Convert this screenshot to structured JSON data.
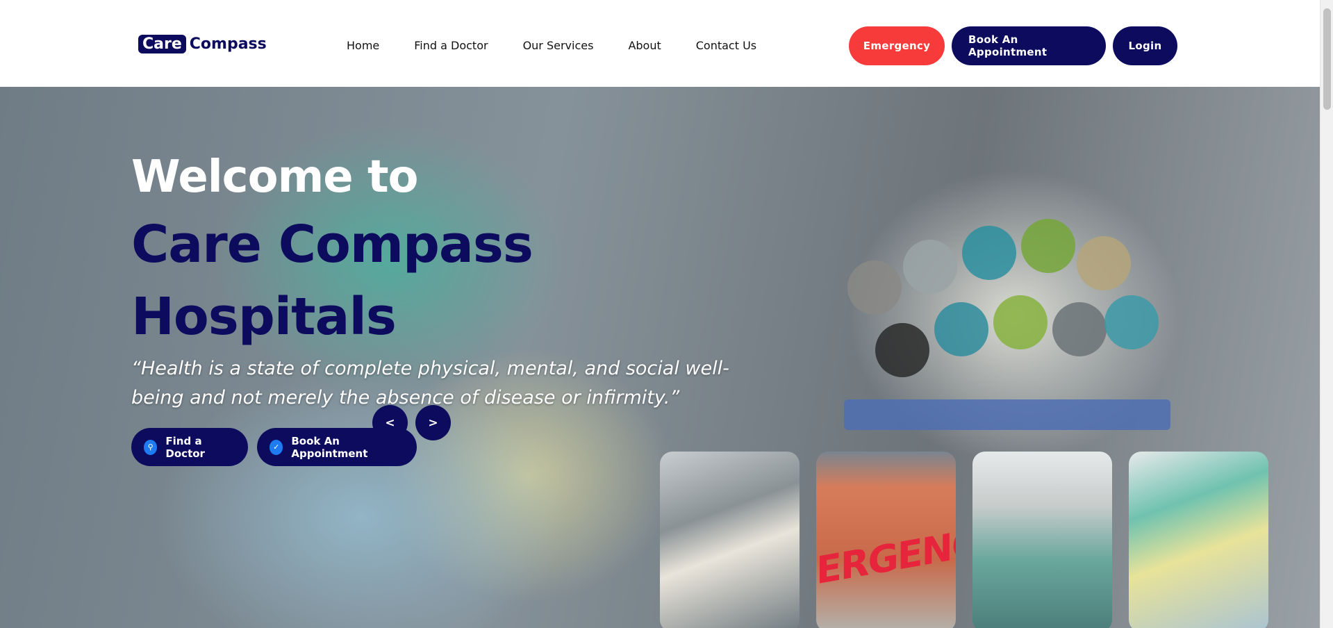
{
  "brand": {
    "logo_box": "Care",
    "logo_text": "Compass"
  },
  "nav": [
    "Home",
    "Find a Doctor",
    "Our Services",
    "About",
    "Contact Us"
  ],
  "header_buttons": {
    "emergency": "Emergency",
    "book": "Book An Appointment",
    "login": "Login"
  },
  "hero": {
    "welcome": "Welcome to",
    "title": "Care Compass Hospitals",
    "quote": "“Health is a state of complete physical, mental, and social well-being and not merely the absence of disease or infirmity.”",
    "cta_find": "Find a Doctor",
    "cta_book": "Book An Appointment",
    "prev": "<",
    "next": ">",
    "card2_sign": "ERGENC"
  },
  "colors": {
    "navy": "#0c0b5e",
    "red": "#f73b3b",
    "accent_blue": "#1e7bf2"
  },
  "icons": {
    "find": "search-icon",
    "book": "check-icon"
  }
}
